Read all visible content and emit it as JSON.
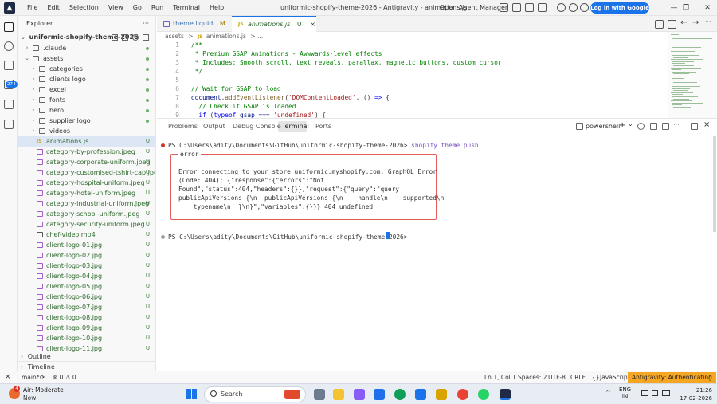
{
  "menu": [
    "File",
    "Edit",
    "Selection",
    "View",
    "Go",
    "Run",
    "Terminal",
    "Help"
  ],
  "window_title": "uniformic-shopify-theme-2026 - Antigravity - animations.js",
  "open_agent_manager": "Open Agent Manager",
  "login_button": "Log in with Google →",
  "explorer": {
    "title": "Explorer",
    "root": "uniformic-shopify-theme-2026",
    "items": [
      {
        "name": ".claude",
        "type": "folder",
        "depth": 1,
        "expanded": false,
        "status": "dot"
      },
      {
        "name": "assets",
        "type": "folder",
        "depth": 1,
        "expanded": true,
        "status": "dot"
      },
      {
        "name": "categories",
        "type": "folder",
        "depth": 2,
        "expanded": false,
        "status": "dot"
      },
      {
        "name": "clients logo",
        "type": "folder",
        "depth": 2,
        "expanded": false,
        "status": "dot"
      },
      {
        "name": "excel",
        "type": "folder",
        "depth": 2,
        "expanded": false,
        "status": "dot"
      },
      {
        "name": "fonts",
        "type": "folder",
        "depth": 2,
        "expanded": false,
        "status": "dot"
      },
      {
        "name": "hero",
        "type": "folder",
        "depth": 2,
        "expanded": false,
        "status": "dot"
      },
      {
        "name": "supplier logo",
        "type": "folder",
        "depth": 2,
        "expanded": false,
        "status": "dot"
      },
      {
        "name": "videos",
        "type": "folder",
        "depth": 2,
        "expanded": false,
        "status": ""
      },
      {
        "name": "animations.js",
        "type": "js",
        "depth": 2,
        "status": "U",
        "selected": true
      },
      {
        "name": "category-by-profession.jpeg",
        "type": "img",
        "depth": 2,
        "status": "U"
      },
      {
        "name": "category-corporate-uniform.jpeg",
        "type": "img",
        "depth": 2,
        "status": "U"
      },
      {
        "name": "category-customised-tshirt-cap.jpeg",
        "type": "img",
        "depth": 2,
        "status": "U"
      },
      {
        "name": "category-hospital-uniform.jpeg",
        "type": "img",
        "depth": 2,
        "status": "U"
      },
      {
        "name": "category-hotel-uniform.jpeg",
        "type": "img",
        "depth": 2,
        "status": "U"
      },
      {
        "name": "category-industrial-uniform.jpeg",
        "type": "img",
        "depth": 2,
        "status": "U"
      },
      {
        "name": "category-school-uniform.jpeg",
        "type": "img",
        "depth": 2,
        "status": "U"
      },
      {
        "name": "category-security-uniform.jpeg",
        "type": "img",
        "depth": 2,
        "status": "U"
      },
      {
        "name": "chef-video.mp4",
        "type": "vid",
        "depth": 2,
        "status": "U"
      },
      {
        "name": "client-logo-01.jpg",
        "type": "img",
        "depth": 2,
        "status": "U"
      },
      {
        "name": "client-logo-02.jpg",
        "type": "img",
        "depth": 2,
        "status": "U"
      },
      {
        "name": "client-logo-03.jpg",
        "type": "img",
        "depth": 2,
        "status": "U"
      },
      {
        "name": "client-logo-04.jpg",
        "type": "img",
        "depth": 2,
        "status": "U"
      },
      {
        "name": "client-logo-05.jpg",
        "type": "img",
        "depth": 2,
        "status": "U"
      },
      {
        "name": "client-logo-06.jpg",
        "type": "img",
        "depth": 2,
        "status": "U"
      },
      {
        "name": "client-logo-07.jpg",
        "type": "img",
        "depth": 2,
        "status": "U"
      },
      {
        "name": "client-logo-08.jpg",
        "type": "img",
        "depth": 2,
        "status": "U"
      },
      {
        "name": "client-logo-09.jpg",
        "type": "img",
        "depth": 2,
        "status": "U"
      },
      {
        "name": "client-logo-10.jpg",
        "type": "img",
        "depth": 2,
        "status": "U"
      },
      {
        "name": "client-logo-11.jpg",
        "type": "img",
        "depth": 2,
        "status": "U"
      }
    ],
    "outline": "Outline",
    "timeline": "Timeline"
  },
  "activity_badge": "279",
  "tabs": [
    {
      "label": "theme.liquid",
      "mark": "M"
    },
    {
      "label": "animations.js",
      "mark": "U",
      "close": "×"
    }
  ],
  "breadcrumb": {
    "folder": "assets",
    "sep": ">",
    "file": "animations.js",
    "more": "> ..."
  },
  "code": [
    {
      "n": "1",
      "parts": [
        {
          "t": "/**",
          "c": "c-comment"
        }
      ]
    },
    {
      "n": "2",
      "parts": [
        {
          "t": " * Premium GSAP Animations - Awwwards-level effects",
          "c": "c-comment"
        }
      ]
    },
    {
      "n": "3",
      "parts": [
        {
          "t": " * Includes: Smooth scroll, text reveals, parallax, magnetic buttons, custom cursor",
          "c": "c-comment"
        }
      ]
    },
    {
      "n": "4",
      "parts": [
        {
          "t": " */",
          "c": "c-comment"
        }
      ]
    },
    {
      "n": "5",
      "parts": []
    },
    {
      "n": "6",
      "parts": [
        {
          "t": "// Wait for GSAP to load",
          "c": "c-comment"
        }
      ]
    },
    {
      "n": "7",
      "parts": [
        {
          "t": "document",
          "c": "c-var"
        },
        {
          "t": ".",
          "c": ""
        },
        {
          "t": "addEventListener",
          "c": "c-fn"
        },
        {
          "t": "(",
          "c": ""
        },
        {
          "t": "'DOMContentLoaded'",
          "c": "c-str"
        },
        {
          "t": ", () ",
          "c": ""
        },
        {
          "t": "=>",
          "c": "c-kw"
        },
        {
          "t": " {",
          "c": ""
        }
      ]
    },
    {
      "n": "8",
      "parts": [
        {
          "t": "  // Check if GSAP is loaded",
          "c": "c-comment"
        }
      ]
    },
    {
      "n": "9",
      "parts": [
        {
          "t": "  ",
          "c": ""
        },
        {
          "t": "if",
          "c": "c-kw"
        },
        {
          "t": " (",
          "c": ""
        },
        {
          "t": "typeof",
          "c": "c-kw"
        },
        {
          "t": " gsap === ",
          "c": "c-var"
        },
        {
          "t": "'undefined'",
          "c": "c-str"
        },
        {
          "t": ") {",
          "c": ""
        }
      ]
    }
  ],
  "panel": {
    "tabs": [
      "Problems",
      "Output",
      "Debug Console",
      "Terminal",
      "Ports"
    ],
    "active_tab": "Terminal",
    "shell": "powershell",
    "plus": "+",
    "chevron": "⌄",
    "more": "···",
    "close": "×"
  },
  "terminal": {
    "prompt1": "PS C:\\Users\\adity\\Documents\\GitHub\\uniformic-shopify-theme-2026>",
    "command": " shopify theme push",
    "error_title": "error",
    "error_lines": [
      "Error connecting to your store uniformic.myshopify.com: GraphQL Error",
      "(Code: 404): {\"response\":{\"errors\":\"Not",
      "Found\",\"status\":404,\"headers\":{}},\"request\":{\"query\":\"query",
      "publicApiVersions {\\n  publicApiVersions {\\n    handle\\n    supported\\n",
      "  __typename\\n  }\\n}\",\"variables\":{}}} 404 undefined"
    ],
    "prompt2": "PS C:\\Users\\adity\\Documents\\GitHub\\uniformic-shopify-theme-2026>"
  },
  "status": {
    "branch": "main*",
    "problems": "⊗ 0 ⚠ 0",
    "position": "Ln 1, Col 1",
    "spaces": "Spaces: 2",
    "encoding": "UTF-8",
    "eol": "CRLF",
    "lang_brace": "{}",
    "language": "JavaScript",
    "agent": "Antigravity: Authenticating"
  },
  "taskbar": {
    "badge": "4",
    "weather_title": "Air: Moderate",
    "weather_sub": "Now",
    "search": "Search",
    "lang1": "ENG",
    "lang2": "IN",
    "time": "21:26",
    "date": "17-02-2026",
    "tray_chevron": "^"
  },
  "colors": {
    "accent": "#1a73e8",
    "agent_status": "#f5a623",
    "error_border": "#e35c5c"
  }
}
